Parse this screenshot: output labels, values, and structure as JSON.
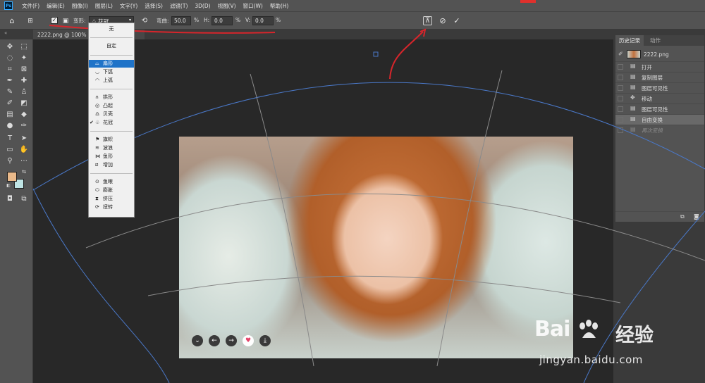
{
  "menubar": {
    "logo": "Ps",
    "items": [
      "文件(F)",
      "编辑(E)",
      "图像(I)",
      "图层(L)",
      "文字(Y)",
      "选择(S)",
      "滤镜(T)",
      "3D(D)",
      "视图(V)",
      "窗口(W)",
      "帮助(H)"
    ]
  },
  "options": {
    "warp_label": "变形:",
    "warp_value": "花冠",
    "bend_label": "弯曲:",
    "bend_value": "50.0",
    "bend_unit": "%",
    "h_label": "H:",
    "h_value": "0.0",
    "h_unit": "%",
    "v_label": "V:",
    "v_value": "0.0",
    "v_unit": "%"
  },
  "document": {
    "tab_title": "2222.png @ 100% (图..."
  },
  "warp_menu": {
    "none": "无",
    "custom": "自定",
    "groups": [
      [
        {
          "label": "扇形",
          "selected": true
        },
        {
          "label": "下弧"
        },
        {
          "label": "上弧"
        }
      ],
      [
        {
          "label": "拱形"
        },
        {
          "label": "凸起"
        },
        {
          "label": "贝壳"
        },
        {
          "label": "花冠",
          "checked": true
        }
      ],
      [
        {
          "label": "旗帜"
        },
        {
          "label": "波浪"
        },
        {
          "label": "鱼形"
        },
        {
          "label": "增加"
        }
      ],
      [
        {
          "label": "鱼眼"
        },
        {
          "label": "膨胀"
        },
        {
          "label": "挤压"
        },
        {
          "label": "扭转"
        }
      ]
    ]
  },
  "panel": {
    "tabs": [
      "历史记录",
      "动作"
    ],
    "snapshot": "2222.png",
    "history": [
      {
        "icon": "document-icon",
        "label": "打开"
      },
      {
        "icon": "document-icon",
        "label": "复制图层"
      },
      {
        "icon": "document-icon",
        "label": "图层可见性"
      },
      {
        "icon": "move-icon",
        "label": "移动"
      },
      {
        "icon": "document-icon",
        "label": "图层可见性"
      },
      {
        "icon": "document-icon",
        "label": "自由变换",
        "active": true
      },
      {
        "icon": "document-icon",
        "label": "再次变换",
        "dim": true
      }
    ]
  },
  "watermark": {
    "logo_left": "Bai",
    "logo_cn": "经验",
    "url": "jingyan.baidu.com"
  },
  "colors": {
    "foreground": "#e9b98a",
    "background": "#bfe4e4",
    "selection": "#1f73c8",
    "annotation": "#d8252b",
    "warp_mesh": "#4a78c8"
  }
}
